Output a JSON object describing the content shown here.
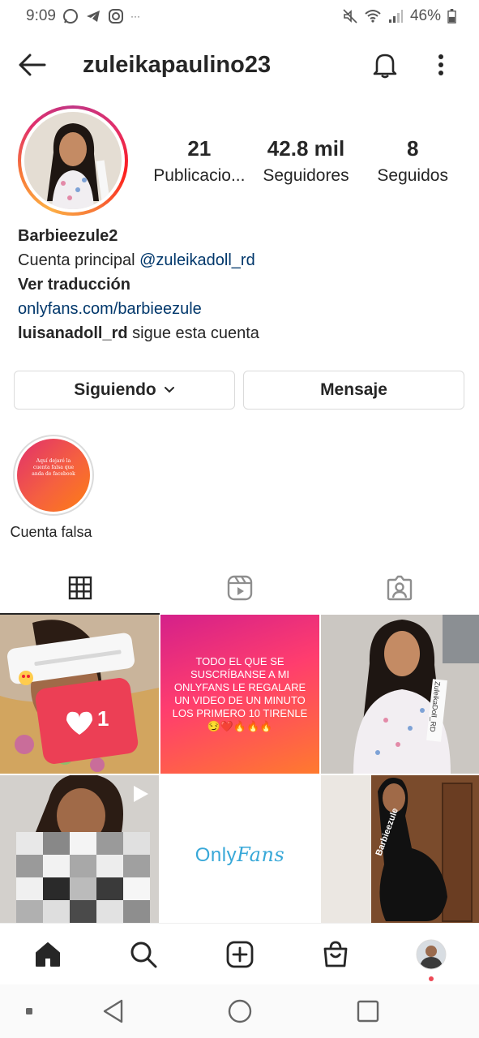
{
  "status_bar": {
    "time": "9:09",
    "battery": "46%",
    "icons": [
      "whatsapp-icon",
      "telegram-icon",
      "instagram-icon",
      "more-notifications-icon",
      "mute-icon",
      "wifi-icon",
      "signal-icon",
      "battery-icon"
    ]
  },
  "header": {
    "username": "zuleikapaulino23",
    "icons": [
      "back-arrow-icon",
      "bell-icon",
      "more-vertical-icon"
    ]
  },
  "profile": {
    "stats": [
      {
        "value": "21",
        "label": "Publicacio..."
      },
      {
        "value": "42.8 mil",
        "label": "Seguidores"
      },
      {
        "value": "8",
        "label": "Seguidos"
      }
    ],
    "name": "Barbieezule2",
    "bio_prefix": "Cuenta principal ",
    "bio_mention": "@zuleikadoll_rd",
    "translate": "Ver traducción",
    "website": "onlyfans.com/barbieezule",
    "followed_by_user": "luisanadoll_rd",
    "followed_by_text": " sigue esta cuenta"
  },
  "actions": {
    "following_label": "Siguiendo",
    "message_label": "Mensaje"
  },
  "highlight": {
    "cover_text": "Aquí dejaré la cuenta falsa que anda de facebook",
    "label": "Cuenta falsa"
  },
  "tabs": [
    "grid-icon",
    "reels-icon",
    "tagged-icon"
  ],
  "posts": {
    "promo_text": "TODO EL QUE SE SUSCRÍBANSE A MI ONLYFANS LE REGALARE UN VIDEO DE UN MINUTO LOS PRIMERO 10 TIRENLE 😏❤️🔥🔥🔥",
    "like_count": "1",
    "post3_watermark": "ZuleikaDoll_RD",
    "post6_watermark": "Barbieezule",
    "of_logo_part1": "Only",
    "of_logo_part2": "Fans"
  },
  "bottom_nav": [
    "home-icon",
    "search-icon",
    "new-post-icon",
    "shop-icon",
    "profile-avatar"
  ],
  "colors": {
    "link": "#00376b",
    "story_gradient_start": "#c13584",
    "story_gradient_end": "#fcaf45",
    "onlyfans_blue": "#38a8d8",
    "notification_dot": "#ed4956"
  }
}
